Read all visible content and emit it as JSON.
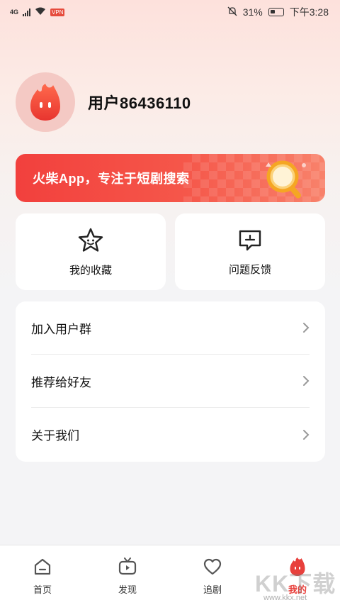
{
  "status_bar": {
    "network": "4G",
    "battery": "31%",
    "time": "下午3:28"
  },
  "profile": {
    "username": "用户86436110"
  },
  "banner": {
    "text": "火柴App，专注于短剧搜索"
  },
  "quick_actions": [
    {
      "label": "我的收藏",
      "icon": "star-icon"
    },
    {
      "label": "问题反馈",
      "icon": "feedback-icon"
    }
  ],
  "menu": {
    "items": [
      {
        "label": "加入用户群"
      },
      {
        "label": "推荐给好友"
      },
      {
        "label": "关于我们"
      }
    ]
  },
  "tabbar": {
    "tabs": [
      {
        "label": "首页",
        "icon": "home-icon"
      },
      {
        "label": "发现",
        "icon": "tv-icon"
      },
      {
        "label": "追剧",
        "icon": "heart-icon"
      },
      {
        "label": "我的",
        "icon": "flame-avatar-icon",
        "active": true
      }
    ]
  },
  "watermark": {
    "text": "KK下载",
    "url": "www.kkx.net"
  },
  "colors": {
    "accent": "#e8403c",
    "banner_start": "#f2403d",
    "banner_end": "#f8826b",
    "avatar_bg": "#f4c9c4"
  }
}
